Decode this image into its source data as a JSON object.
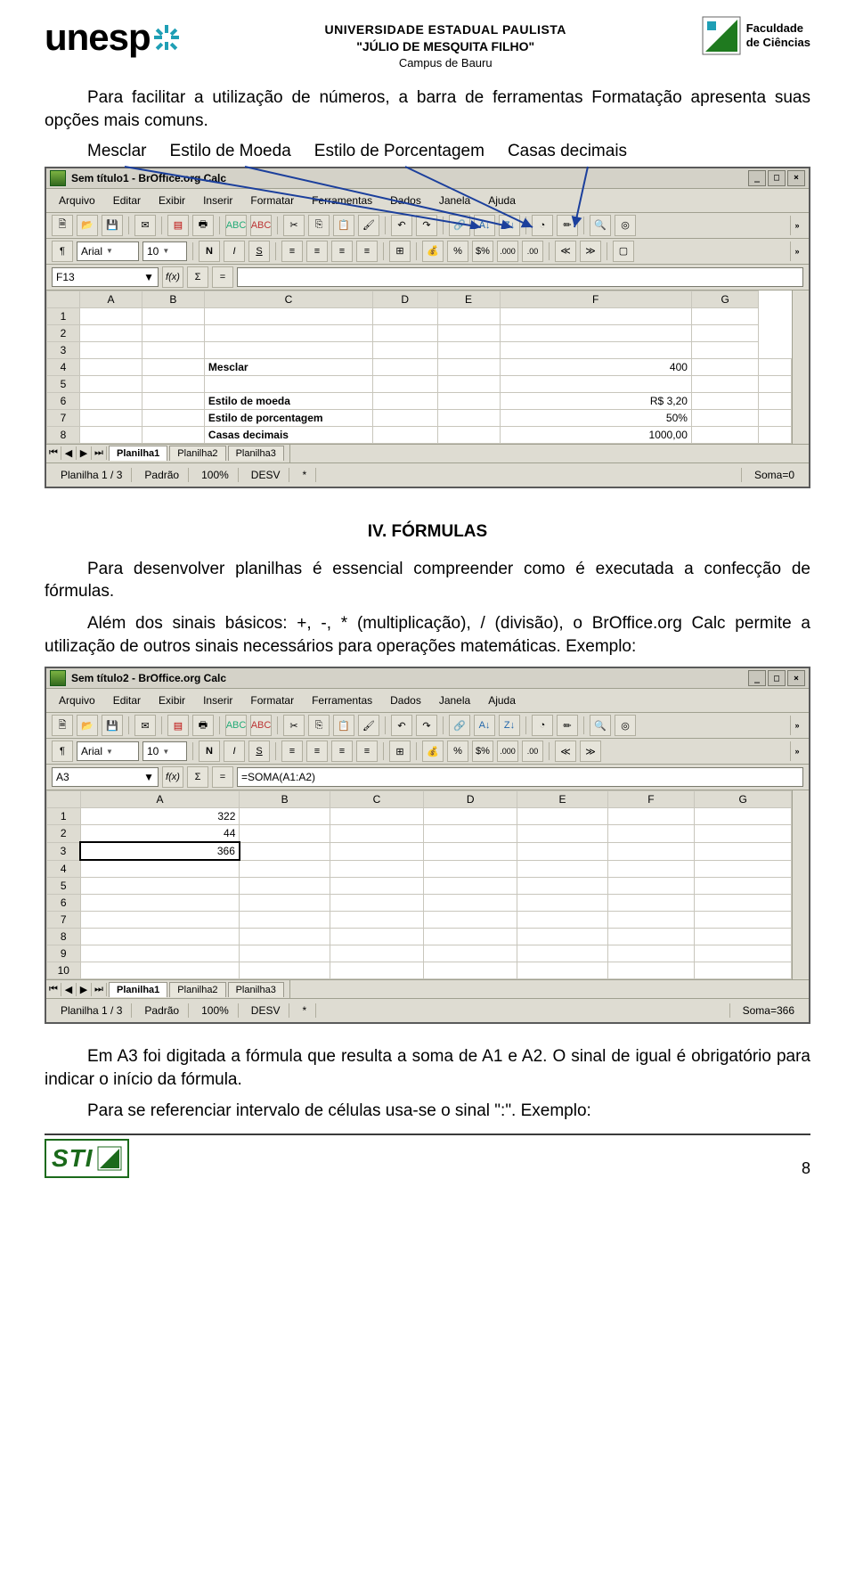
{
  "header": {
    "unesp": "unesp",
    "uni_line1": "UNIVERSIDADE ESTADUAL PAULISTA",
    "uni_line2": "\"JÚLIO DE MESQUITA FILHO\"",
    "uni_line3": "Campus de Bauru",
    "fac_line1": "Faculdade",
    "fac_line2": "de Ciências"
  },
  "para1": "Para facilitar a utilização de números, a barra de ferramentas Formatação apresenta suas opções mais comuns.",
  "labels": {
    "l1": "Mesclar",
    "l2": "Estilo de Moeda",
    "l3": "Estilo de Porcentagem",
    "l4": "Casas decimais"
  },
  "ss1": {
    "title": "Sem título1 - BrOffice.org Calc",
    "menus": [
      "Arquivo",
      "Editar",
      "Exibir",
      "Inserir",
      "Formatar",
      "Ferramentas",
      "Dados",
      "Janela",
      "Ajuda"
    ],
    "font": "Arial",
    "size": "10",
    "cellref": "F13",
    "formula": "",
    "cols": [
      "",
      "A",
      "B",
      "C",
      "D",
      "E",
      "F",
      "G"
    ],
    "rows": [
      {
        "n": "1",
        "cells": [
          "",
          "",
          "",
          "",
          "",
          "",
          ""
        ]
      },
      {
        "n": "2",
        "cells": [
          "",
          "",
          "",
          "",
          "",
          "",
          ""
        ]
      },
      {
        "n": "3",
        "cells": [
          "",
          "",
          "",
          "",
          "",
          "",
          ""
        ]
      },
      {
        "n": "4",
        "cells": [
          "",
          "",
          "Mesclar",
          "",
          "",
          "400",
          "",
          ""
        ],
        "bold": true
      },
      {
        "n": "5",
        "cells": [
          "",
          "",
          "",
          "",
          "",
          "",
          "",
          ""
        ]
      },
      {
        "n": "6",
        "cells": [
          "",
          "",
          "Estilo de moeda",
          "",
          "",
          "R$ 3,20",
          "",
          ""
        ],
        "bold": true
      },
      {
        "n": "7",
        "cells": [
          "",
          "",
          "Estilo de porcentagem",
          "",
          "",
          "50%",
          "",
          ""
        ],
        "bold": true
      },
      {
        "n": "8",
        "cells": [
          "",
          "",
          "Casas decimais",
          "",
          "",
          "1000,00",
          "",
          ""
        ],
        "bold": true
      }
    ],
    "tabs": [
      "Planilha1",
      "Planilha2",
      "Planilha3"
    ],
    "status": {
      "sheet": "Planilha 1 / 3",
      "style": "Padrão",
      "zoom": "100%",
      "mode": "DESV",
      "mark": "*",
      "sum": "Soma=0"
    }
  },
  "section4_title": "IV.   FÓRMULAS",
  "para2": "Para desenvolver planilhas é essencial compreender como é executada a confecção de fórmulas.",
  "para3": "Além dos sinais básicos: +, -, * (multiplicação), / (divisão), o BrOffice.org Calc permite a utilização de outros sinais necessários para   operações matemáticas. Exemplo:",
  "ss2": {
    "title": "Sem título2 - BrOffice.org Calc",
    "menus": [
      "Arquivo",
      "Editar",
      "Exibir",
      "Inserir",
      "Formatar",
      "Ferramentas",
      "Dados",
      "Janela",
      "Ajuda"
    ],
    "font": "Arial",
    "size": "10",
    "cellref": "A3",
    "formula": "=SOMA(A1:A2)",
    "cols": [
      "",
      "A",
      "B",
      "C",
      "D",
      "E",
      "F",
      "G"
    ],
    "rows": [
      {
        "n": "1",
        "cells": [
          "322",
          "",
          "",
          "",
          "",
          "",
          ""
        ]
      },
      {
        "n": "2",
        "cells": [
          "44",
          "",
          "",
          "",
          "",
          "",
          ""
        ]
      },
      {
        "n": "3",
        "cells": [
          "366",
          "",
          "",
          "",
          "",
          "",
          ""
        ],
        "sel": true
      },
      {
        "n": "4",
        "cells": [
          "",
          "",
          "",
          "",
          "",
          "",
          ""
        ]
      },
      {
        "n": "5",
        "cells": [
          "",
          "",
          "",
          "",
          "",
          "",
          ""
        ]
      },
      {
        "n": "6",
        "cells": [
          "",
          "",
          "",
          "",
          "",
          "",
          ""
        ]
      },
      {
        "n": "7",
        "cells": [
          "",
          "",
          "",
          "",
          "",
          "",
          ""
        ]
      },
      {
        "n": "8",
        "cells": [
          "",
          "",
          "",
          "",
          "",
          "",
          ""
        ]
      },
      {
        "n": "9",
        "cells": [
          "",
          "",
          "",
          "",
          "",
          "",
          ""
        ]
      },
      {
        "n": "10",
        "cells": [
          "",
          "",
          "",
          "",
          "",
          "",
          ""
        ]
      }
    ],
    "tabs": [
      "Planilha1",
      "Planilha2",
      "Planilha3"
    ],
    "status": {
      "sheet": "Planilha 1 / 3",
      "style": "Padrão",
      "zoom": "100%",
      "mode": "DESV",
      "mark": "*",
      "sum": "Soma=366"
    }
  },
  "para4_a": "Em A3 foi digitada a fórmula que resulta a soma de A1 e A2. O sinal de igual é obrigatório para indicar o início da fórmula.",
  "para4_b": "Para se referenciar intervalo de células usa-se o sinal \":\". Exemplo:",
  "footer": {
    "sti": "STI",
    "page": "8"
  }
}
